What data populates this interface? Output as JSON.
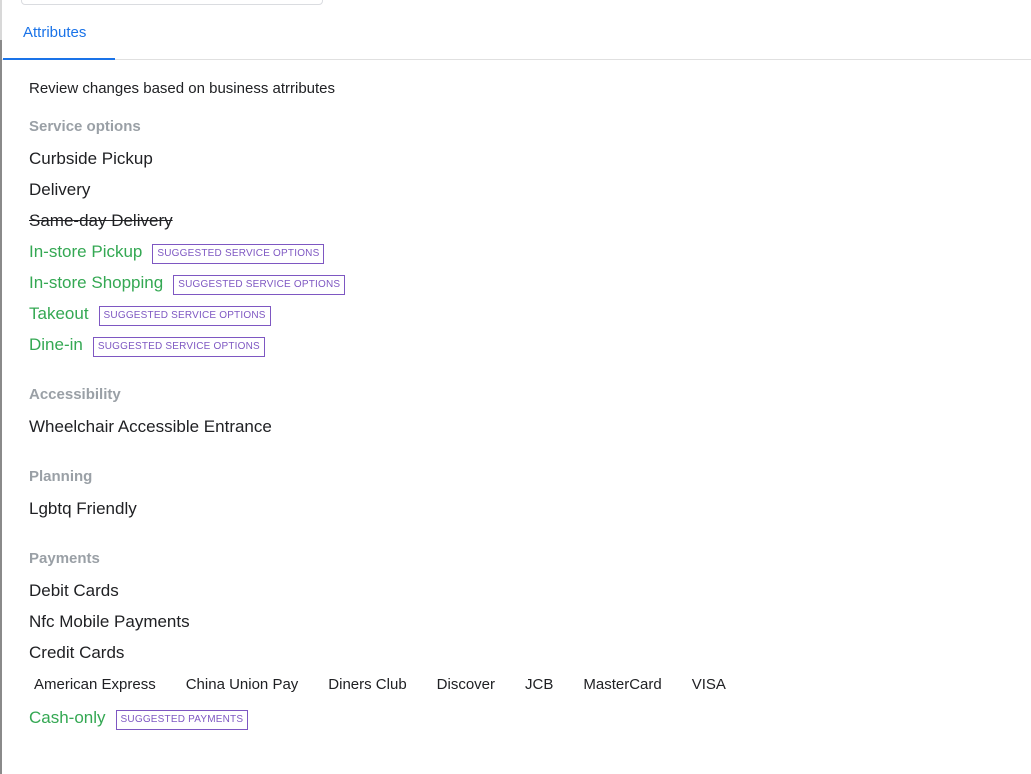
{
  "tabs": [
    {
      "label": "Attributes"
    }
  ],
  "intro": "Review changes based on business atrributes",
  "sections": [
    {
      "title": "Service options",
      "items": [
        {
          "label": "Curbside Pickup"
        },
        {
          "label": "Delivery"
        },
        {
          "label": "Same-day Delivery",
          "status": "removed"
        },
        {
          "label": "In-store Pickup",
          "status": "suggested",
          "badge": "SUGGESTED SERVICE OPTIONS"
        },
        {
          "label": "In-store Shopping",
          "status": "suggested",
          "badge": "SUGGESTED SERVICE OPTIONS"
        },
        {
          "label": "Takeout",
          "status": "suggested",
          "badge": "SUGGESTED SERVICE OPTIONS"
        },
        {
          "label": "Dine-in",
          "status": "suggested",
          "badge": "SUGGESTED SERVICE OPTIONS"
        }
      ]
    },
    {
      "title": "Accessibility",
      "items": [
        {
          "label": "Wheelchair Accessible Entrance"
        }
      ]
    },
    {
      "title": "Planning",
      "items": [
        {
          "label": "Lgbtq Friendly"
        }
      ]
    },
    {
      "title": "Payments",
      "items": [
        {
          "label": "Debit Cards"
        },
        {
          "label": "Nfc Mobile Payments"
        },
        {
          "label": "Credit Cards",
          "subitems": [
            "American Express",
            "China Union Pay",
            "Diners Club",
            "Discover",
            "JCB",
            "MasterCard",
            "VISA"
          ]
        },
        {
          "label": "Cash-only",
          "status": "suggested",
          "badge": "SUGGESTED PAYMENTS"
        }
      ]
    }
  ],
  "colors": {
    "accent": "#1a73e8",
    "suggested": "#34a853",
    "badge": "#7e57c2",
    "section_title": "#9aa0a6"
  }
}
